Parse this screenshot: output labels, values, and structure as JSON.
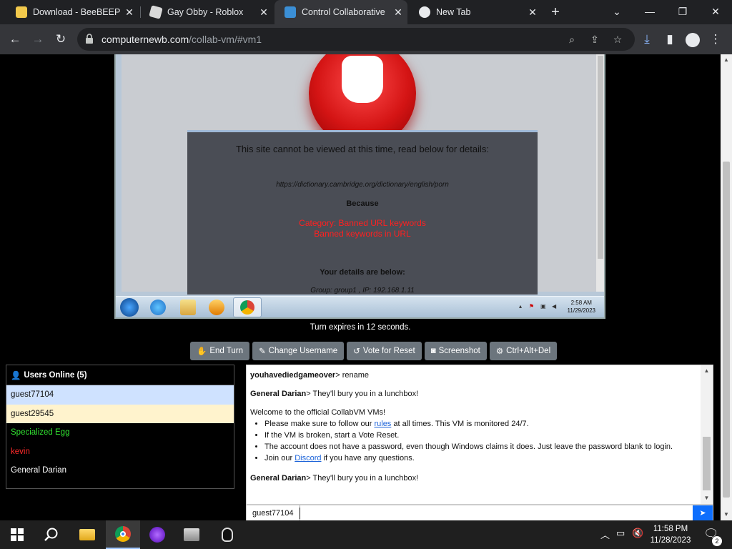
{
  "browser": {
    "tabs": [
      {
        "title": "Download - BeeBEEP -",
        "active": false
      },
      {
        "title": "Gay Obby - Roblox",
        "active": false
      },
      {
        "title": "Control Collaborative",
        "active": true
      },
      {
        "title": "New Tab",
        "active": false
      }
    ],
    "url_host": "computernewb.com",
    "url_path": "/collab-vm/#vm1"
  },
  "vm": {
    "block_title": "This site cannot be viewed at this time, read below for details:",
    "blocked_url": "https://dictionary.cambridge.org/dictionary/english/porn",
    "because": "Because",
    "category_line1": "Category: Banned URL keywords",
    "category_line2": "Banned keywords in URL",
    "details_heading": "Your details are below:",
    "group_line": "Group: group1 , IP: 192.168.1.11",
    "clock_time": "2:58 AM",
    "clock_date": "11/29/2023"
  },
  "controls": {
    "turn_text": "Turn expires in 12 seconds.",
    "end_turn": "End Turn",
    "change_username": "Change Username",
    "vote_reset": "Vote for Reset",
    "screenshot": "Screenshot",
    "ctrl_alt_del": "Ctrl+Alt+Del"
  },
  "users": {
    "heading": "Users Online (5)",
    "list": [
      "guest77104",
      "guest29545",
      "Specialized Egg",
      "kevin",
      "General Darian"
    ]
  },
  "chat": {
    "messages": [
      {
        "user": "youhavediedgameover",
        "text": "> rename"
      },
      {
        "user": "General Darian",
        "text": "> They'll bury you in a lunchbox!"
      }
    ],
    "welcome_title": "Welcome to the official CollabVM VMs!",
    "rule1_pre": "Please make sure to follow our ",
    "rule1_link": "rules",
    "rule1_post": " at all times. This VM is monitored 24/7.",
    "rule2": "If the VM is broken, start a Vote Reset.",
    "rule3": "The account does not have a password, even though Windows claims it does. Just leave the password blank to login.",
    "rule4_pre": "Join our ",
    "rule4_link": "Discord",
    "rule4_post": " if you have any questions.",
    "last_user": "General Darian",
    "last_text": "> They'll bury you in a lunchbox!",
    "input_username": "guest77104"
  },
  "taskbar": {
    "time": "11:58 PM",
    "date": "11/28/2023",
    "notification_count": "2"
  },
  "colors": {
    "chrome_bg": "#202124",
    "toolbar_bg": "#35363a",
    "button_gray": "#6c757d",
    "send_blue": "#0d6efd"
  }
}
